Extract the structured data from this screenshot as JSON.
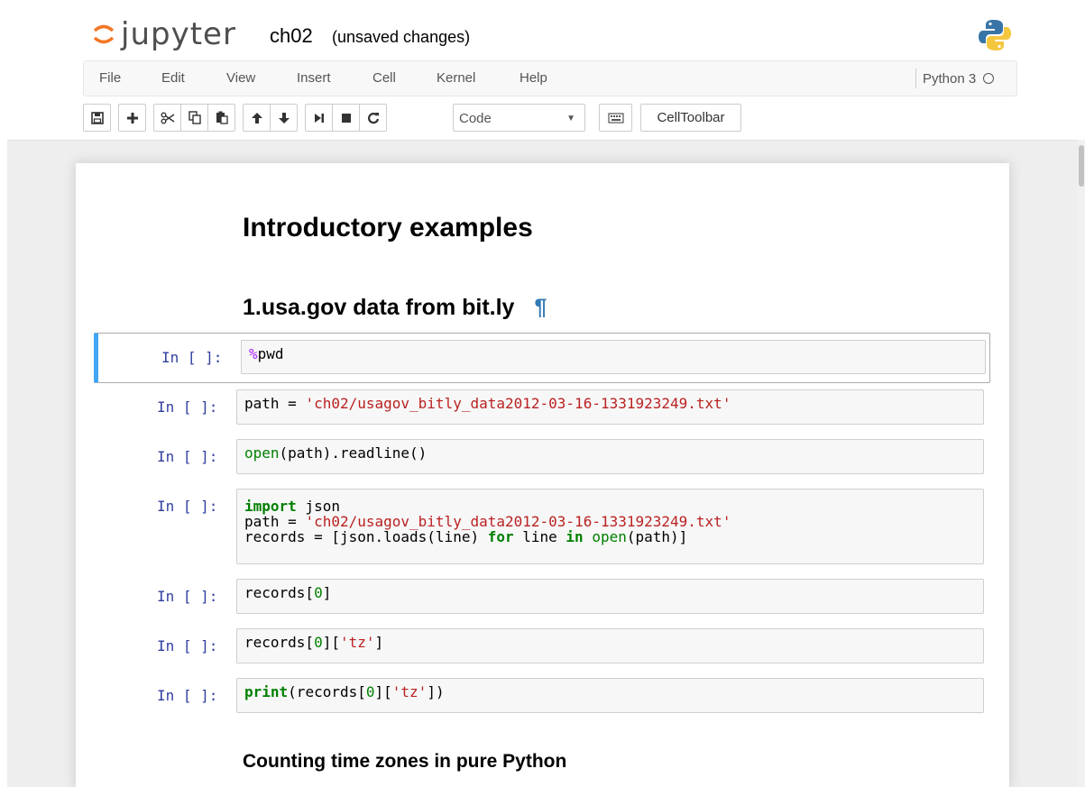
{
  "header": {
    "logo_text": "jupyter",
    "notebook_name": "ch02",
    "save_status": "(unsaved changes)"
  },
  "menubar": {
    "items": [
      "File",
      "Edit",
      "View",
      "Insert",
      "Cell",
      "Kernel",
      "Help"
    ],
    "kernel_name": "Python 3"
  },
  "toolbar": {
    "cell_type": "Code",
    "celltoolbar_label": "CellToolbar"
  },
  "notebook": {
    "heading1": "Introductory examples",
    "heading2": "1.usa.gov data from bit.ly",
    "anchor_symbol": "¶",
    "heading3": "Counting time zones in pure Python",
    "prompt": "In [ ]:",
    "cells": [
      {
        "line1": "pwd",
        "magic": "%"
      },
      {
        "var": "path = ",
        "string": "'ch02/usagov_bitly_data2012-03-16-1331923249.txt'"
      },
      {
        "builtin": "open",
        "rest": "(path).readline()"
      },
      {
        "kw_import": "import",
        "module": " json",
        "line2_var": "path = ",
        "line2_string": "'ch02/usagov_bitly_data2012-03-16-1331923249.txt'",
        "line3_a": "records = [json.loads(line) ",
        "kw_for": "for",
        "line3_b": " line ",
        "kw_in": "in",
        "line3_c": " ",
        "line3_builtin": "open",
        "line3_d": "(path)]"
      },
      {
        "a": "records[",
        "num": "0",
        "b": "]"
      },
      {
        "a": "records[",
        "num": "0",
        "b": "][",
        "str": "'tz'",
        "c": "]"
      },
      {
        "kw": "print",
        "a": "(records[",
        "num": "0",
        "b": "][",
        "str": "'tz'",
        "c": "])"
      }
    ]
  }
}
